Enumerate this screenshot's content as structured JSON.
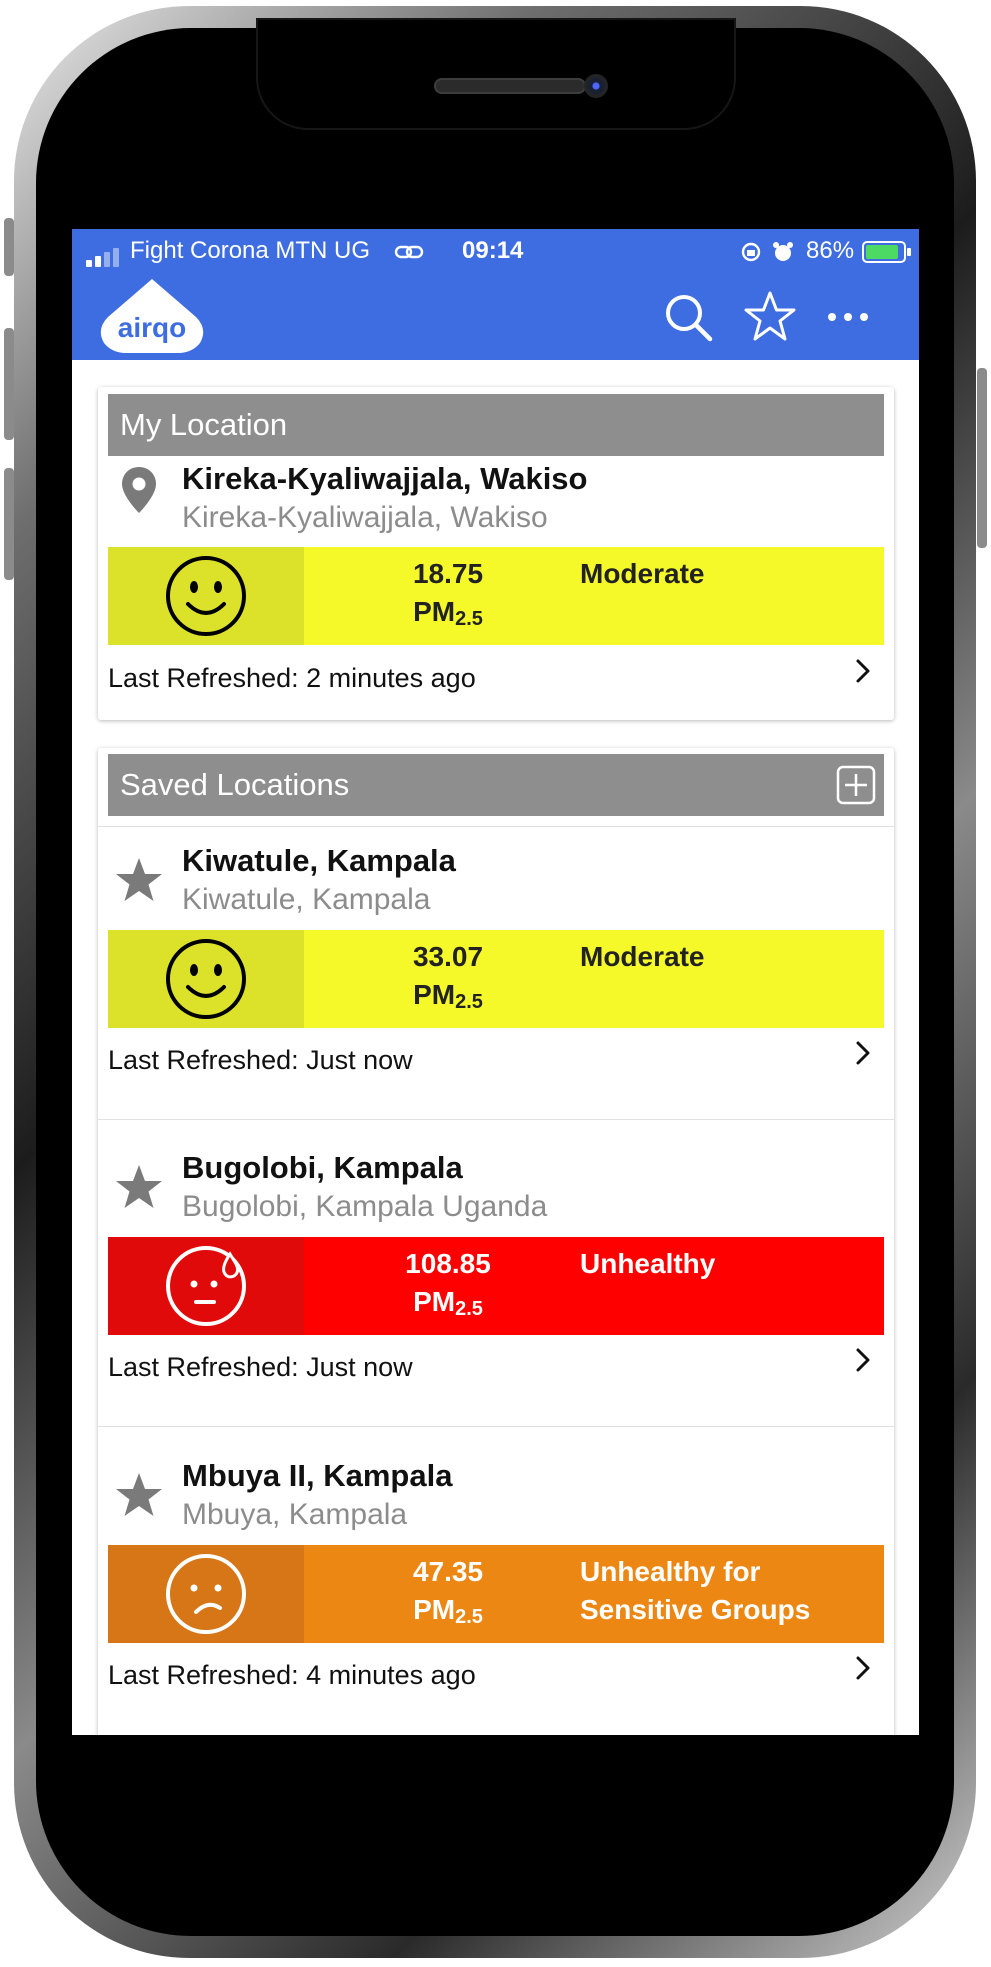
{
  "status_bar": {
    "carrier": "Fight Corona MTN UG",
    "time": "09:14",
    "battery": "86%"
  },
  "header": {
    "logo_text": "airqo",
    "icons": [
      "search-icon",
      "star-outline-icon",
      "more-icon"
    ],
    "color": "#3e6ce1"
  },
  "my_location": {
    "section_title": "My Location",
    "item": {
      "title": "Kireka-Kyaliwajjala, Wakiso",
      "subtitle": "Kireka-Kyaliwajjala, Wakiso",
      "value": "18.75",
      "unit": "PM",
      "unit_sub": "2.5",
      "category": "Moderate",
      "refreshed": "Last Refreshed: 2 minutes ago",
      "icon": "location-pin-icon"
    }
  },
  "saved_locations": {
    "section_title": "Saved Locations",
    "add_icon": "add-icon",
    "items": [
      {
        "title": "Kiwatule, Kampala",
        "subtitle": "Kiwatule, Kampala",
        "value": "33.07",
        "unit": "PM",
        "unit_sub": "2.5",
        "category": "Moderate",
        "refreshed": "Last Refreshed: Just now",
        "icon": "star-icon"
      },
      {
        "title": "Bugolobi, Kampala",
        "subtitle": "Bugolobi, Kampala Uganda",
        "value": "108.85",
        "unit": "PM",
        "unit_sub": "2.5",
        "category": "Unhealthy",
        "refreshed": "Last Refreshed: Just now",
        "icon": "star-icon"
      },
      {
        "title": "Mbuya II, Kampala",
        "subtitle": "Mbuya, Kampala",
        "value": "47.35",
        "unit": "PM",
        "unit_sub": "2.5",
        "category_line1": "Unhealthy for",
        "category_line2": "Sensitive Groups",
        "refreshed": "Last Refreshed: 4 minutes ago",
        "icon": "star-icon"
      }
    ]
  },
  "colors": {
    "moderate": "#f5f929",
    "moderate_face": "#dce12a",
    "unhealthy": "#ff0000",
    "unhealthy_face": "#e10a0a",
    "sensitive": "#ec8714",
    "sensitive_face": "#d67616"
  }
}
